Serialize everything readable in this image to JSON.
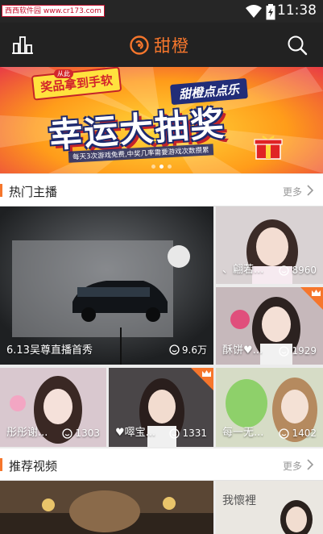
{
  "status_bar": {
    "watermark": "西西软件园 www.cr173.com",
    "time": "11:38",
    "icons": [
      "wifi-icon",
      "battery-icon"
    ]
  },
  "app_bar": {
    "left_icon": "bar-chart-icon",
    "logo_text": "甜橙",
    "right_icon": "search-icon"
  },
  "banner": {
    "sticker_tag": "从此",
    "sticker": "奖品拿到手软",
    "sub_title": "甜橙点点乐",
    "main_title": "幸运大抽奖",
    "caption": "每天3次游戏免费,中奖几率需要游戏次数攒累",
    "dots": 3,
    "active_dot": 1,
    "colors": {
      "bg": "#ff9c1a",
      "title_outline": "#1e2a6e",
      "accent": "#d3262b"
    }
  },
  "sections": {
    "hot": {
      "title": "热门主播",
      "more": "更多"
    },
    "recommend": {
      "title": "推荐视频",
      "more": "更多"
    }
  },
  "hot_streams": [
    {
      "name": "6.13吴尊直播首秀",
      "viewers": "9.6万",
      "crown": false
    },
    {
      "name": "、翩若...",
      "viewers": "8960",
      "crown": false
    },
    {
      "name": "酥饼♥...",
      "viewers": "1929",
      "crown": true
    },
    {
      "name": "彤彤谢...",
      "viewers": "1303",
      "crown": false
    },
    {
      "name": "♥噿宝...",
      "viewers": "1331",
      "crown": true
    },
    {
      "name": "每一无...",
      "viewers": "1402",
      "crown": false
    }
  ],
  "recommend_videos": [
    {
      "overlay_text": ""
    },
    {
      "overlay_text": "我懷裡"
    }
  ],
  "colors": {
    "accent": "#f6762c",
    "app_bar": "#222222",
    "status_bar": "#262626"
  }
}
